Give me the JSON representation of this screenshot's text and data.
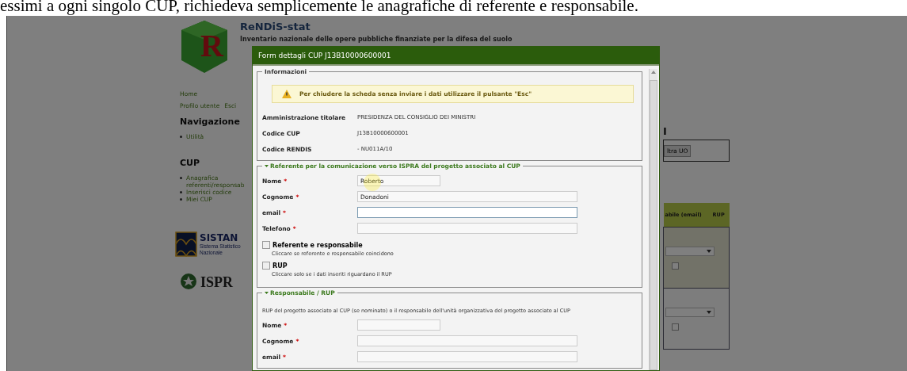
{
  "caption": "essimi a ogni singolo CUP, richiedeva semplicemente le anagrafiche di referente e responsabile.",
  "background_page": {
    "logo_letter": "R",
    "site_title": "ReNDiS-stat",
    "site_subtitle": "Inventario nazionale delle opere pubbliche finanziate per la difesa del suolo",
    "nav_links": [
      "Home",
      "Profilo utente",
      "Esci"
    ],
    "sections": [
      {
        "heading": "Navigazione",
        "items": [
          "Utilità"
        ]
      },
      {
        "heading": "CUP",
        "items": [
          "Anagrafica referenti/responsab",
          "Inserisci codice",
          "Miei CUP"
        ]
      }
    ],
    "sistan_logo": {
      "name": "SISTAN",
      "subtitle_1": "Sistema Statistico",
      "subtitle_2": "Nazionale"
    },
    "ispra_logo": {
      "name": "ISPR"
    },
    "heading_fragment": "I",
    "filter_button": "ltra UO",
    "table": {
      "columns": [
        "abile (email)",
        "RUP"
      ],
      "rows": [
        {
          "rup_checked": false
        },
        {
          "rup_checked": false
        }
      ]
    }
  },
  "modal": {
    "title": "Form dettagli CUP J13B10000600001",
    "info": {
      "legend": "Informazioni",
      "warning": "Per chiudere la scheda senza inviare i dati utilizzare il pulsante \"Esc\"",
      "rows": [
        {
          "label": "Amministrazione titolare",
          "value": "PRESIDENZA DEL CONSIGLIO DEI MINISTRI"
        },
        {
          "label": "Codice CUP",
          "value": "J13B10000600001"
        },
        {
          "label": "Codice RENDIS",
          "value": "- NU011A/10"
        }
      ]
    },
    "sections": [
      {
        "legend": "Referente per la comunicazione verso ISPRA del progetto associato al CUP",
        "expanded": true,
        "fields": [
          {
            "label": "Nome",
            "required_mark": "*",
            "value": "Roberto",
            "focused": false
          },
          {
            "label": "Cognome",
            "required_mark": "*",
            "value": "Donadoni",
            "focused": false
          },
          {
            "label": "email",
            "required_mark": "*",
            "focused": true
          },
          {
            "label": "Telefono",
            "required_mark": "*",
            "focused": false
          }
        ],
        "checkboxes": [
          {
            "label": "Referente e responsabile",
            "hint": "Cliccare se referente e responsabile coincidono",
            "checked": false
          },
          {
            "label": "RUP",
            "hint": "Cliccare solo se i dati inseriti riguardano il RUP",
            "checked": false
          }
        ]
      },
      {
        "legend": "Responsabile / RUP",
        "expanded": true,
        "description": "RUP del progetto associato al CUP (se nominato) o il responsabile dell'unità organizzativa del progetto associato al CUP",
        "fields": [
          {
            "label": "Nome",
            "required_mark": "*",
            "focused": false
          },
          {
            "label": "Cognome",
            "required_mark": "*",
            "focused": false
          },
          {
            "label": "email",
            "required_mark": "*",
            "focused": false
          }
        ]
      }
    ]
  }
}
